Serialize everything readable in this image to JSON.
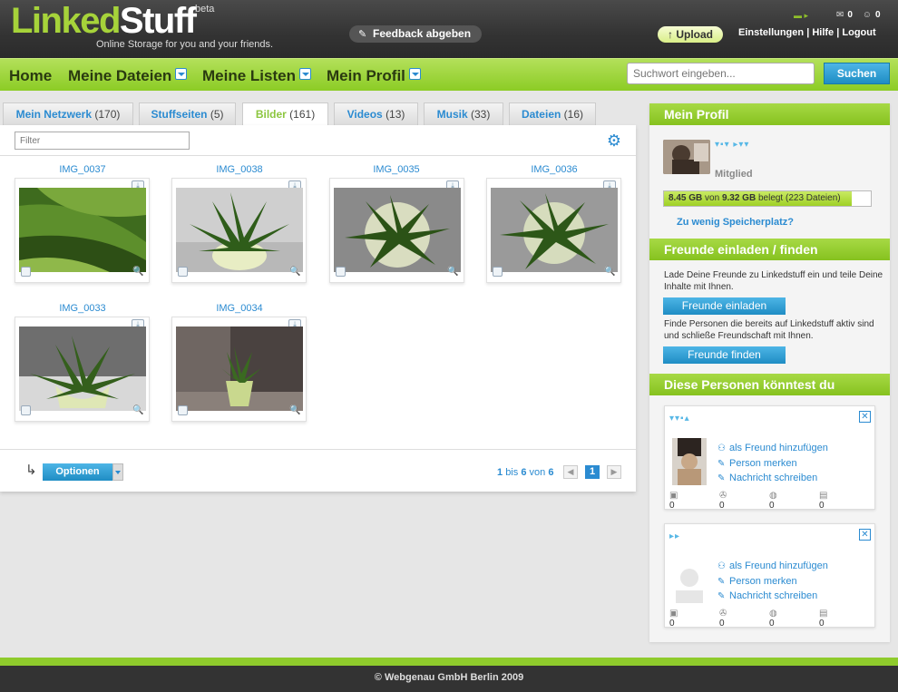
{
  "header": {
    "logo_part1": "Linked",
    "logo_part2": "Stuff",
    "beta": "beta",
    "slogan": "Online Storage for you and your friends.",
    "feedback": "Feedback abgeben",
    "upload": "Upload",
    "links": [
      "Einstellungen",
      "Hilfe",
      "Logout"
    ],
    "separator": "|",
    "messages_count": "0",
    "friends_count": "0"
  },
  "nav": {
    "items": [
      "Home",
      "Meine Dateien",
      "Meine Listen",
      "Mein Profil"
    ],
    "search_placeholder": "Suchwort eingeben...",
    "search_button": "Suchen"
  },
  "tabs": [
    {
      "label": "Mein Netzwerk",
      "count": "(170)"
    },
    {
      "label": "Stuffseiten",
      "count": "(5)"
    },
    {
      "label": "Bilder",
      "count": "(161)"
    },
    {
      "label": "Videos",
      "count": "(13)"
    },
    {
      "label": "Musik",
      "count": "(33)"
    },
    {
      "label": "Dateien",
      "count": "(16)"
    }
  ],
  "content": {
    "filter_placeholder": "Filter",
    "images": [
      "IMG_0037",
      "IMG_0038",
      "IMG_0035",
      "IMG_0036",
      "IMG_0033",
      "IMG_0034"
    ],
    "options_button": "Optionen",
    "pager_from": "1",
    "pager_bis": "bis",
    "pager_to": "6",
    "pager_von": "von",
    "pager_total": "6",
    "page": "1"
  },
  "sidebar": {
    "profile_title": "Mein Profil",
    "role": "Mitglied",
    "storage_used": "8.45 GB",
    "storage_von": "von",
    "storage_total": "9.32 GB",
    "storage_suffix": "belegt (223 Dateien)",
    "storage_fraction": 0.907,
    "more_space": "Zu wenig Speicherplatz?",
    "invite_title": "Freunde einladen / finden",
    "invite_text": "Lade Deine Freunde zu Linkedstuff ein und teile Deine Inhalte mit Ihnen.",
    "invite_button": "Freunde einladen",
    "find_text": "Finde Personen die bereits auf Linkedstuff aktiv sind und schließe Freundschaft mit Ihnen.",
    "find_button": "Freunde finden",
    "suggest_title": "Diese Personen könntest du",
    "actions": [
      "als Freund hinzufügen",
      "Person merken",
      "Nachricht schreiben"
    ],
    "stat_values": [
      "0",
      "0",
      "0",
      "0"
    ]
  },
  "footer": {
    "copyright": "© Webgenau GmbH Berlin 2009"
  },
  "colors": {
    "accent_green": "#8ccc25",
    "link_blue": "#2b8bd1",
    "header_dark": "#333333"
  }
}
